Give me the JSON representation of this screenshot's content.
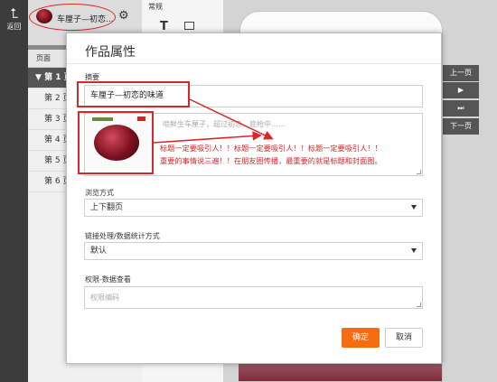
{
  "rail": {
    "back_label": "返回"
  },
  "topbar": {
    "work_title": "车厘子—初恋..."
  },
  "toolbox": {
    "title": "常规",
    "text_tool": "T"
  },
  "pages": {
    "header": "页面",
    "items": [
      "第 1 页",
      "第 2 页",
      "第 3 页",
      "第 4 页",
      "第 5 页",
      "第 6 页"
    ]
  },
  "nav": {
    "prev": "上一页",
    "play": "▶",
    "last": "⏭",
    "next": "下一页"
  },
  "modal": {
    "title": "作品属性",
    "summary_label": "摘要",
    "summary_value": "车厘子—初恋的味道",
    "desc_placeholder": "啮鲜生车厘子，超过初恋，底抢中……",
    "browse_label": "浏览方式",
    "browse_value": "上下翻页",
    "link_label": "链接处理/数据统计方式",
    "link_value": "默认",
    "perm_label": "权限-数据查看",
    "perm_placeholder": "权限编码",
    "ok": "确定",
    "cancel": "取消"
  },
  "annotation": {
    "line1": "标题一定要吸引人！！标题一定要吸引人！！标题一定要吸引人！！",
    "line2": "重要的事情说三遍！！在朋友圈传播，最重要的就是标题和封面图。",
    "color": "#d9262b"
  },
  "colors": {
    "accent": "#f56d13",
    "rail": "#3c3c3c",
    "active_row": "#555555"
  }
}
